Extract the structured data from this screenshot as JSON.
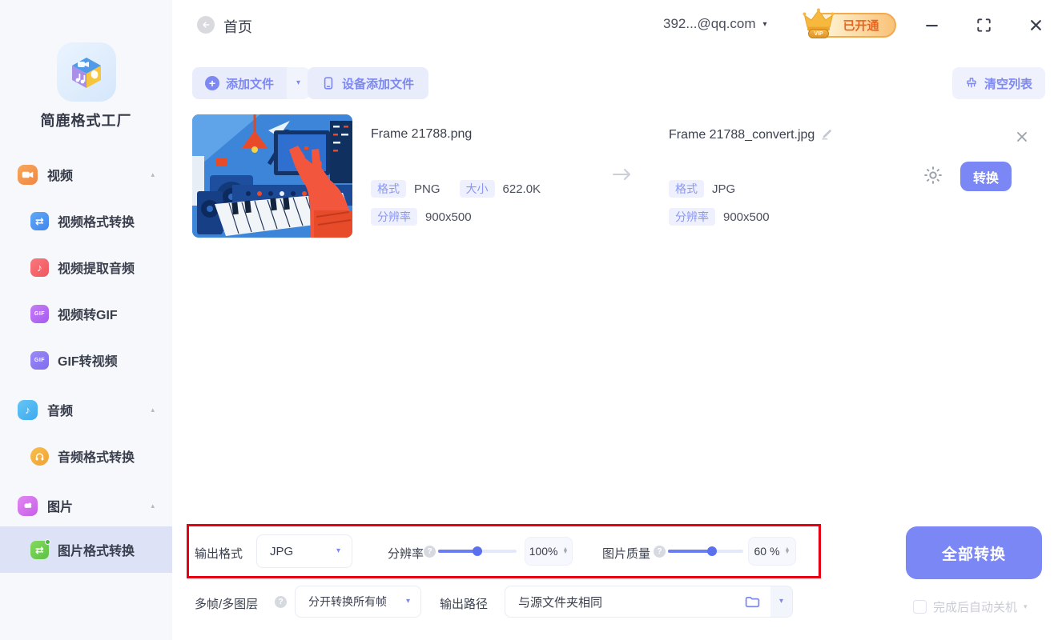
{
  "app": {
    "name": "简鹿格式工厂"
  },
  "topbar": {
    "page_title": "首页",
    "account": "392...@qq.com",
    "vip": {
      "label": "VIP",
      "status": "已开通"
    }
  },
  "toolbar": {
    "add_files": "添加文件",
    "device_add_files": "设备添加文件",
    "clear_list": "清空列表"
  },
  "sidebar": {
    "items": [
      {
        "label": "视频"
      },
      {
        "label": "视频格式转换"
      },
      {
        "label": "视频提取音频"
      },
      {
        "label": "视频转GIF",
        "icon_text": "GIF"
      },
      {
        "label": "GIF转视频",
        "icon_text": "GIF"
      },
      {
        "label": "音频"
      },
      {
        "label": "音频格式转换"
      },
      {
        "label": "图片"
      },
      {
        "label": "图片格式转换"
      }
    ]
  },
  "file": {
    "source": {
      "name": "Frame 21788.png",
      "format_label": "格式",
      "format": "PNG",
      "size_label": "大小",
      "size": "622.0K",
      "resolution_label": "分辨率",
      "resolution": "900x500"
    },
    "output": {
      "name": "Frame 21788_convert.jpg",
      "format_label": "格式",
      "format": "JPG",
      "resolution_label": "分辨率",
      "resolution": "900x500"
    },
    "convert_button": "转换"
  },
  "settings": {
    "output_format_label": "输出格式",
    "output_format_value": "JPG",
    "resolution_label": "分辨率",
    "resolution_value": "100%",
    "resolution_slider_percent": 50,
    "quality_label": "图片质量",
    "quality_value": "60",
    "quality_unit": "%",
    "quality_slider_percent": 58,
    "multiframe_label": "多帧/多图层",
    "multiframe_value": "分开转换所有帧",
    "output_path_label": "输出路径",
    "output_path_value": "与源文件夹相同"
  },
  "footer": {
    "convert_all_button": "全部转换",
    "shutdown_label": "完成后自动关机"
  },
  "icons": {
    "help": "?",
    "caret_down": "▾",
    "caret_up": "▴",
    "plus": "+",
    "spin_up": "▲",
    "spin_down": "▼",
    "note": "♪",
    "swap": "⇄"
  },
  "colors": {
    "accent": "#7b87f4",
    "accent_light_bg": "#e9edfb",
    "chip_bg": "#eef1fd",
    "chip_text": "#8a96f3",
    "highlight_red": "#e60012",
    "vip_text": "#e8641f"
  }
}
